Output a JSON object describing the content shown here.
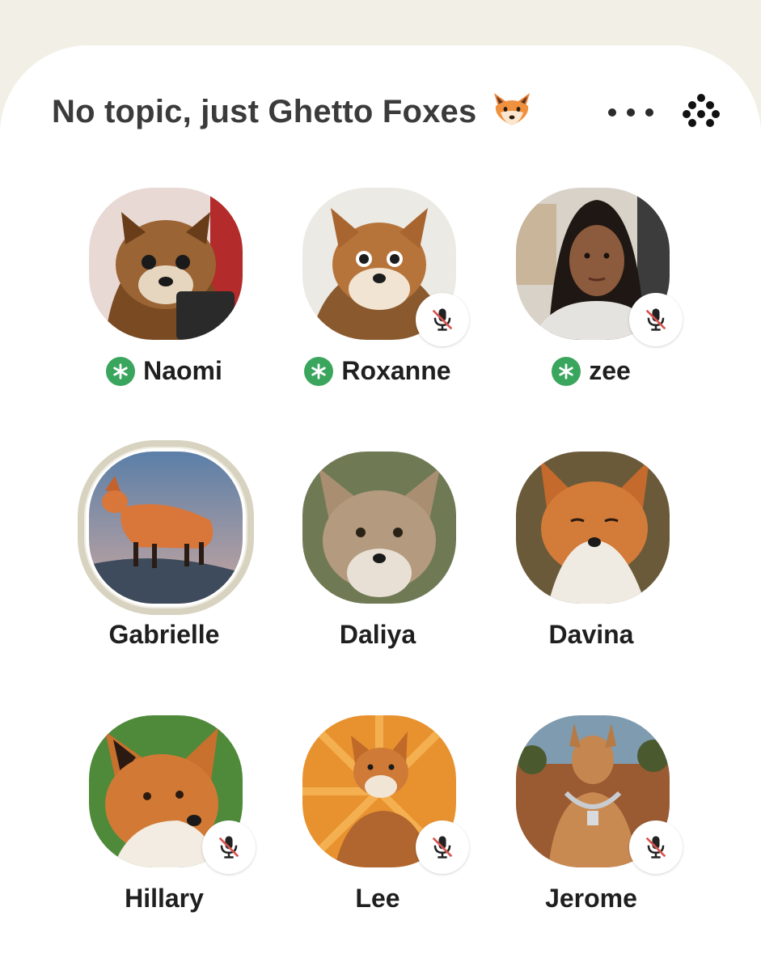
{
  "room": {
    "title": "No topic, just Ghetto Foxes",
    "title_emoji": "fox-face-emoji"
  },
  "header_actions": {
    "more_icon": "ellipsis-icon",
    "grid_icon": "clubhouse-dots-icon"
  },
  "colors": {
    "background": "#f2f0e6",
    "sheet": "#ffffff",
    "title": "#3b3b3b",
    "moderator_badge": "#3aa55d",
    "mute_slash": "#d9534f",
    "speaking_ring": "#d7d3c0"
  },
  "speakers": [
    {
      "name": "Naomi",
      "moderator": true,
      "muted": false,
      "speaking": false,
      "avatar": "fox-avatar"
    },
    {
      "name": "Roxanne",
      "moderator": true,
      "muted": true,
      "speaking": false,
      "avatar": "fox-avatar"
    },
    {
      "name": "zee",
      "moderator": true,
      "muted": true,
      "speaking": false,
      "avatar": "person-avatar"
    },
    {
      "name": "Gabrielle",
      "moderator": false,
      "muted": false,
      "speaking": true,
      "avatar": "fox-avatar"
    },
    {
      "name": "Daliya",
      "moderator": false,
      "muted": false,
      "speaking": false,
      "avatar": "fox-avatar"
    },
    {
      "name": "Davina",
      "moderator": false,
      "muted": false,
      "speaking": false,
      "avatar": "fox-avatar"
    },
    {
      "name": "Hillary",
      "moderator": false,
      "muted": true,
      "speaking": false,
      "avatar": "fox-avatar"
    },
    {
      "name": "Lee",
      "moderator": false,
      "muted": true,
      "speaking": false,
      "avatar": "fox-avatar"
    },
    {
      "name": "Jerome",
      "moderator": false,
      "muted": true,
      "speaking": false,
      "avatar": "kangaroo-avatar"
    }
  ]
}
